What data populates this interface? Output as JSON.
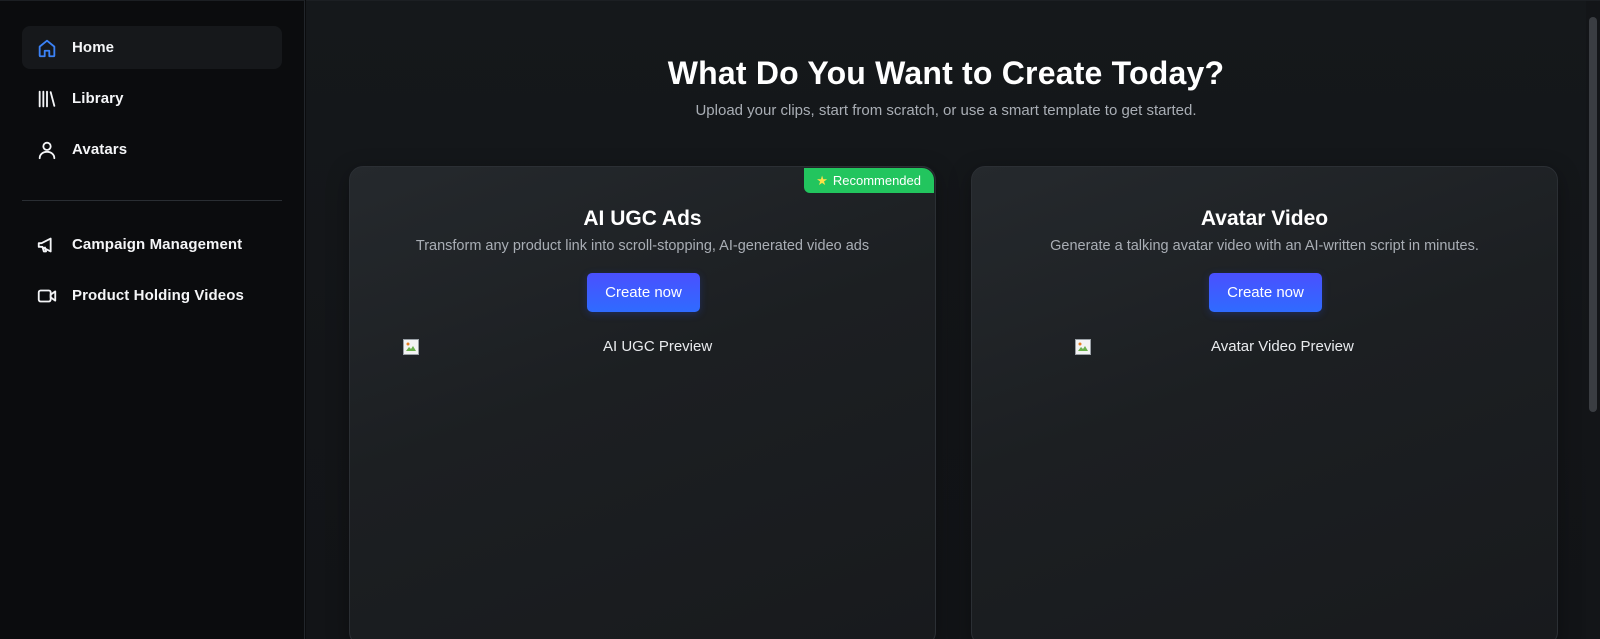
{
  "sidebar": {
    "items": [
      {
        "label": "Home",
        "icon": "home-icon",
        "active": true
      },
      {
        "label": "Library",
        "icon": "library-icon",
        "active": false
      },
      {
        "label": "Avatars",
        "icon": "user-icon",
        "active": false
      },
      {
        "label": "Campaign Management",
        "icon": "megaphone-icon",
        "active": false
      },
      {
        "label": "Product Holding Videos",
        "icon": "video-camera-icon",
        "active": false
      }
    ]
  },
  "main": {
    "title": "What Do You Want to Create Today?",
    "subtitle": "Upload your clips, start from scratch, or use a smart template to get started.",
    "cards": [
      {
        "title": "AI UGC Ads",
        "description": "Transform any product link into scroll-stopping, AI-generated video ads",
        "button_label": "Create now",
        "preview_alt": "AI UGC Preview",
        "badge": "Recommended"
      },
      {
        "title": "Avatar Video",
        "description": "Generate a talking avatar video with an AI-written script in minutes.",
        "button_label": "Create now",
        "preview_alt": "Avatar Video Preview"
      }
    ]
  },
  "colors": {
    "accent": "#3b5bff",
    "badge": "#22c55e",
    "active_icon": "#3b82f6"
  }
}
